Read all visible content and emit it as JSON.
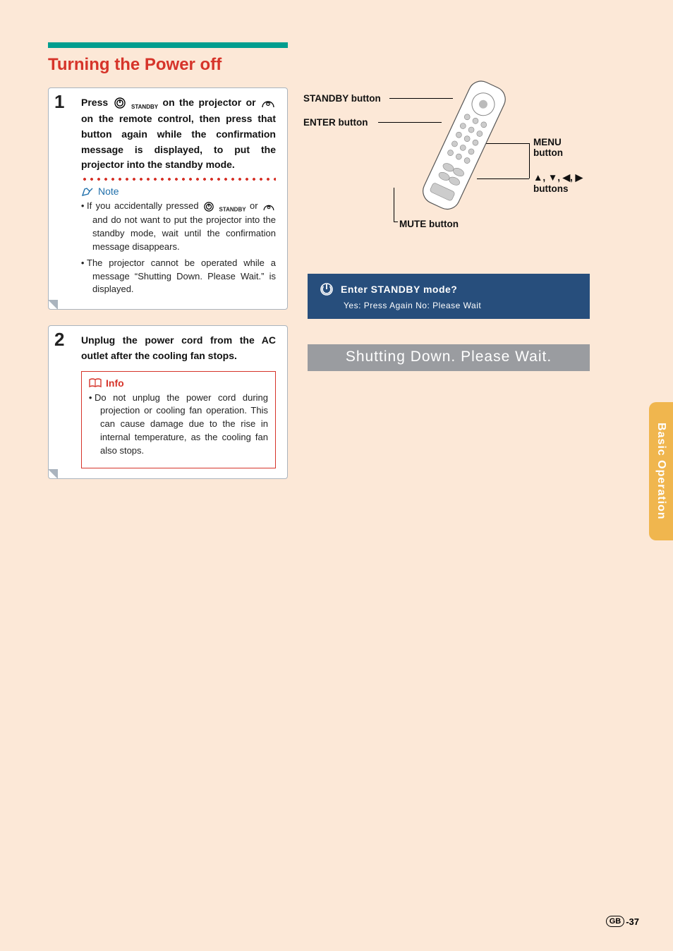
{
  "heading": "Turning the Power off",
  "steps": [
    {
      "num": "1",
      "text_pre": "Press ",
      "icon_label_1": "STANDBY",
      "text_mid1": " on the projector or ",
      "icon_label_2": "STANDBY",
      "text_post": " on the remote control, then press that button again while the confirmation message is displayed, to put the projector into the standby mode."
    },
    {
      "num": "2",
      "text": "Unplug the power cord from the AC outlet after the cooling fan stops."
    }
  ],
  "note": {
    "label": "Note",
    "items": [
      {
        "pre": "If you accidentally pressed ",
        "label1": "STANDBY",
        "mid": " or ",
        "label2": "STANDBY",
        "post": " and do not want to put the projector into the standby mode, wait until the confirmation message disappears."
      },
      {
        "full": "The projector cannot be operated while a message “Shutting Down. Please Wait.” is displayed."
      }
    ]
  },
  "info": {
    "label": "Info",
    "text": "Do not unplug the power cord during projection or cooling fan operation. This can cause damage due to the rise in internal temperature, as the cooling fan also stops."
  },
  "remote_labels": {
    "standby": "STANDBY button",
    "enter": "ENTER button",
    "menu": "MENU\nbutton",
    "arrows": "▲, ▼, ◀, ▶\nbuttons",
    "mute": "MUTE button"
  },
  "osd": {
    "line1": "Enter STANDBY mode?",
    "line2": "Yes: Press Again   No: Please Wait"
  },
  "shutdown": "Shutting Down. Please Wait.",
  "side_tab": "Basic Operation",
  "page_region": "GB",
  "page_num": "-37"
}
